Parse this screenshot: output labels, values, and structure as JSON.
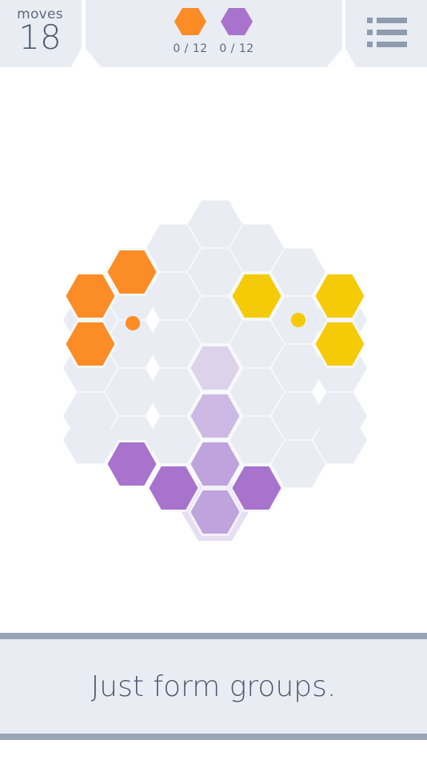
{
  "header": {
    "moves_label": "moves",
    "moves_value": "18",
    "goals": [
      {
        "color": "#fb8c26",
        "text": "0 / 12",
        "name": "orange"
      },
      {
        "color": "#a873cc",
        "text": "0 / 12",
        "name": "purple"
      }
    ],
    "menu_icon": "list-menu-icon"
  },
  "board": {
    "colors": {
      "empty": "#e9edf3",
      "orange": "#fb8c26",
      "yellow": "#f4cb06",
      "purple": "#a873cc",
      "purple_light_1": "#dcd3ea",
      "purple_light_2": "#cdb9e3",
      "purple_light_3": "#bea3dc",
      "purple_highlight": "#e6def1"
    }
  },
  "footer": {
    "message": "Just form groups."
  }
}
